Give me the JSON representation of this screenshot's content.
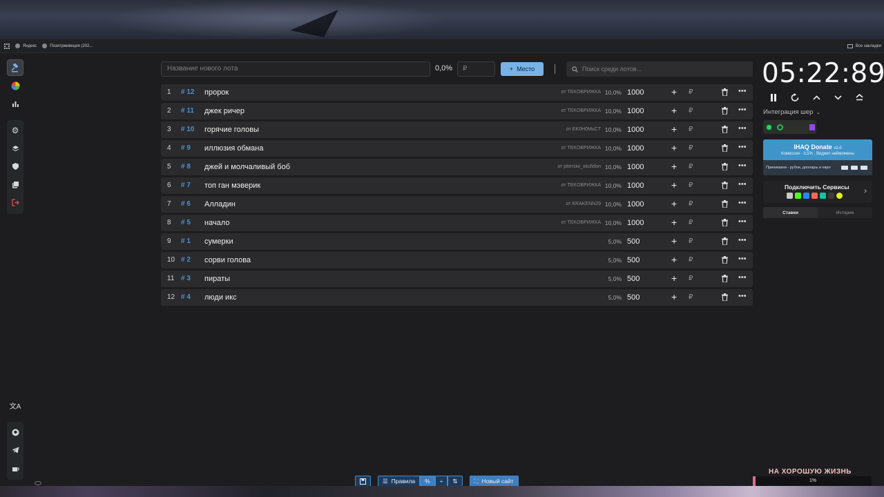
{
  "bookmarks": {
    "items": [
      {
        "label": "Яндекс"
      },
      {
        "label": "Позитрживеция (202..."
      }
    ],
    "all_label": "Все закладки"
  },
  "controls": {
    "new_lot_placeholder": "Название нового лота",
    "percent": "0,0%",
    "amount_placeholder": "₽",
    "place_button": "Место",
    "search_placeholder": "Поиск среди лотов..."
  },
  "lots": [
    {
      "idx": "1",
      "num": "# 12",
      "name": "пророк",
      "from": "от TEKOBPИЖКА",
      "share": "10,0%",
      "amount": "1000"
    },
    {
      "idx": "2",
      "num": "# 11",
      "name": "джек ричер",
      "from": "от TEKOBPИЖКА",
      "share": "10,0%",
      "amount": "1000"
    },
    {
      "idx": "3",
      "num": "# 10",
      "name": "горячие головы",
      "from": "от EK0H0MuCT",
      "share": "10,0%",
      "amount": "1000"
    },
    {
      "idx": "4",
      "num": "# 9",
      "name": "иллюзия обмана",
      "from": "от TEKOBPИЖКА",
      "share": "10,0%",
      "amount": "1000"
    },
    {
      "idx": "5",
      "num": "# 8",
      "name": "джей и молчаливый боб",
      "from": "от piterskii_skufidon",
      "share": "10,0%",
      "amount": "1000"
    },
    {
      "idx": "6",
      "num": "# 7",
      "name": "топ ган мэверик",
      "from": "от TEKOBPИЖКА",
      "share": "10,0%",
      "amount": "1000"
    },
    {
      "idx": "7",
      "num": "# 6",
      "name": "Алладин",
      "from": "от KRAKENN29",
      "share": "10,0%",
      "amount": "1000"
    },
    {
      "idx": "8",
      "num": "# 5",
      "name": "начало",
      "from": "от TEKOBPИЖКА",
      "share": "10,0%",
      "amount": "1000"
    },
    {
      "idx": "9",
      "num": "# 1",
      "name": "сумерки",
      "from": "",
      "share": "5,0%",
      "amount": "500"
    },
    {
      "idx": "10",
      "num": "# 2",
      "name": "сорви голова",
      "from": "",
      "share": "5,0%",
      "amount": "500"
    },
    {
      "idx": "11",
      "num": "# 3",
      "name": "пираты",
      "from": "",
      "share": "5,0%",
      "amount": "500"
    },
    {
      "idx": "12",
      "num": "# 4",
      "name": "люди икс",
      "from": "",
      "share": "5,0%",
      "amount": "500"
    }
  ],
  "lot_currency": "₽",
  "timer": {
    "value": "05:22:89"
  },
  "integration": {
    "label": "Интеграция шер"
  },
  "donate": {
    "title": "IHAQ Donate",
    "version": "v2.0",
    "commission": "Комиссия - 3,5% , Виджет неймомены",
    "accepts": "Принимаем - рубли, доллары и евро"
  },
  "connect": {
    "title": "Подключить Сервисы"
  },
  "tabs": {
    "bets": "Ставки",
    "history": "История"
  },
  "toolbar": {
    "rules": "Правила",
    "new_site": "Новый сайт"
  },
  "overlay": {
    "slogan": "НА ХОРОШУЮ ЖИЗНЬ",
    "progress_label": "1%",
    "progress": 0.01
  },
  "colors": {
    "accent": "#78b3e8",
    "lot_number": "#4b8fd6",
    "progress": "#e06a8a"
  }
}
